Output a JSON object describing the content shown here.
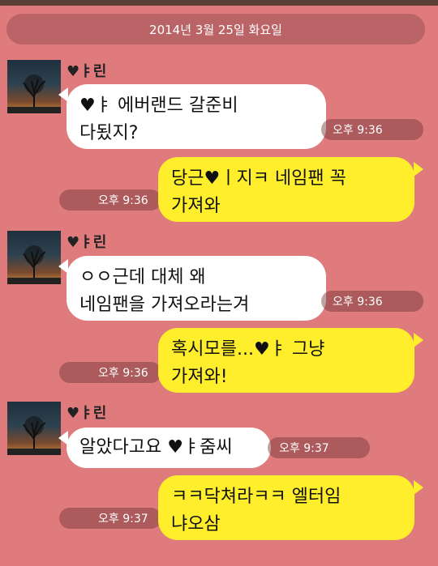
{
  "date_divider": "2014년 3월 25일 화요일",
  "contact": {
    "name": "♥ㅑ린"
  },
  "messages": [
    {
      "side": "in",
      "text": "♥ㅑ 에버랜드 갈준비\n다됬지?",
      "time": "오후 9:36"
    },
    {
      "side": "out",
      "text": "당근♥ㅣ지ㅋ 네임팬 꼭\n가져와",
      "time": "오후 9:36"
    },
    {
      "side": "in",
      "text": "ㅇㅇ근데 대체 왜\n네임팬을 가져오라는겨",
      "time": "오후 9:36"
    },
    {
      "side": "out",
      "text": "혹시모를...♥ㅑ 그냥\n가져와!",
      "time": "오후 9:36"
    },
    {
      "side": "in",
      "text": "알았다고요 ♥ㅑ줌씨",
      "time": "오후 9:37"
    },
    {
      "side": "out",
      "text": "ㅋㅋ닥쳐라ㅋㅋ 엘터임\n냐오삼",
      "time": "오후 9:37"
    }
  ]
}
